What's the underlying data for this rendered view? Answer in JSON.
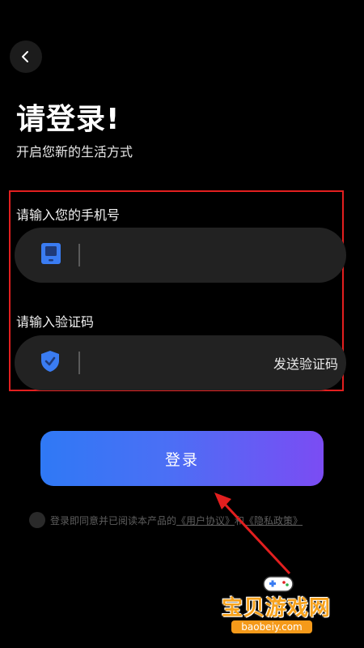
{
  "header": {
    "back_icon": "chevron-left-icon"
  },
  "title": "请登录!",
  "subtitle": "开启您新的生活方式",
  "phone": {
    "label": "请输入您的手机号",
    "icon": "phone-icon",
    "placeholder": "",
    "value": ""
  },
  "code": {
    "label": "请输入验证码",
    "icon": "shield-check-icon",
    "placeholder": "",
    "value": "",
    "send_label": "发送验证码"
  },
  "login_button": "登录",
  "agreement": {
    "prefix": "登录即同意并已阅读本产品的",
    "user_agreement": "《用户协议》",
    "and": "和",
    "privacy": "《隐私政策》"
  },
  "watermark": {
    "name": "宝贝游戏网",
    "url": "baobeiy.com"
  },
  "colors": {
    "accent_start": "#2f79f5",
    "accent_end": "#7b4cf3",
    "highlight_box": "#e21f1f",
    "icon_blue": "#3a7cf2"
  }
}
